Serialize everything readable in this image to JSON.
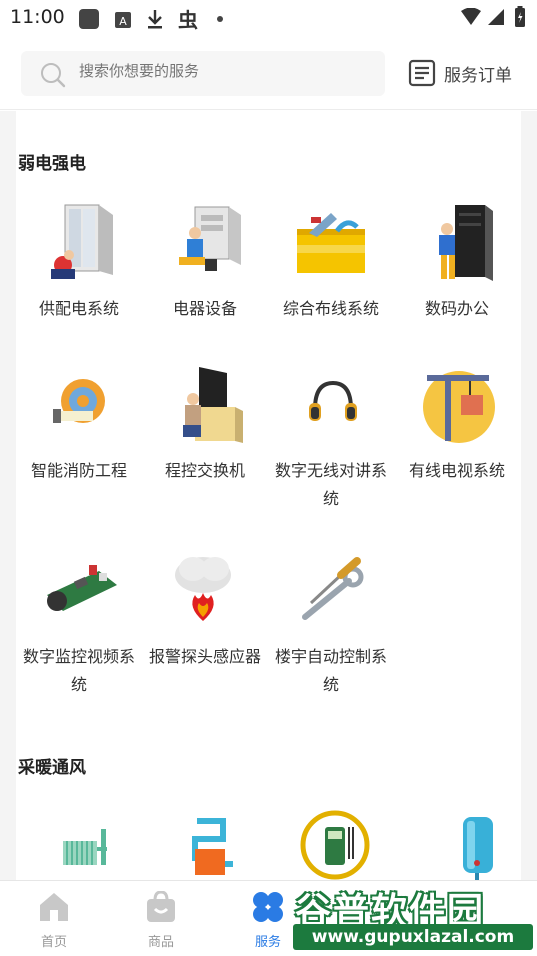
{
  "status_bar": {
    "time": "11:00"
  },
  "search": {
    "placeholder": "搜索你想要的服务"
  },
  "orders": {
    "label": "服务订单"
  },
  "sections": [
    {
      "title": "弱电强电",
      "items": [
        {
          "label": "供配电系统",
          "icon": "power-cabinet-icon"
        },
        {
          "label": "电器设备",
          "icon": "electrical-equipment-icon"
        },
        {
          "label": "综合布线系统",
          "icon": "toolbox-icon"
        },
        {
          "label": "数码办公",
          "icon": "server-rack-icon"
        },
        {
          "label": "智能消防工程",
          "icon": "tape-measure-icon"
        },
        {
          "label": "程控交换机",
          "icon": "switchboard-icon"
        },
        {
          "label": "数字无线对讲系统",
          "icon": "headphones-icon"
        },
        {
          "label": "有线电视系统",
          "icon": "crane-icon"
        },
        {
          "label": "数字监控视频系统",
          "icon": "video-board-icon"
        },
        {
          "label": "报警探头感应器",
          "icon": "fire-alarm-icon"
        },
        {
          "label": "楼宇自动控制系统",
          "icon": "wrench-screwdriver-icon"
        }
      ]
    },
    {
      "title": "采暖通风",
      "items": [
        {
          "label": "",
          "icon": "radiator-icon"
        },
        {
          "label": "",
          "icon": "pipe-heater-icon"
        },
        {
          "label": "",
          "icon": "multimeter-icon"
        },
        {
          "label": "",
          "icon": "water-heater-icon"
        }
      ]
    }
  ],
  "tabs": [
    {
      "label": "首页",
      "icon": "home-icon",
      "active": false
    },
    {
      "label": "商品",
      "icon": "bag-icon",
      "active": false
    },
    {
      "label": "服务",
      "icon": "clover-icon",
      "active": true
    }
  ],
  "watermark": {
    "title": "谷普软件园",
    "url": "www.gupuxlazal.com"
  },
  "colors": {
    "accent": "#2a7be4",
    "watermark_green": "#1c7a3e"
  }
}
